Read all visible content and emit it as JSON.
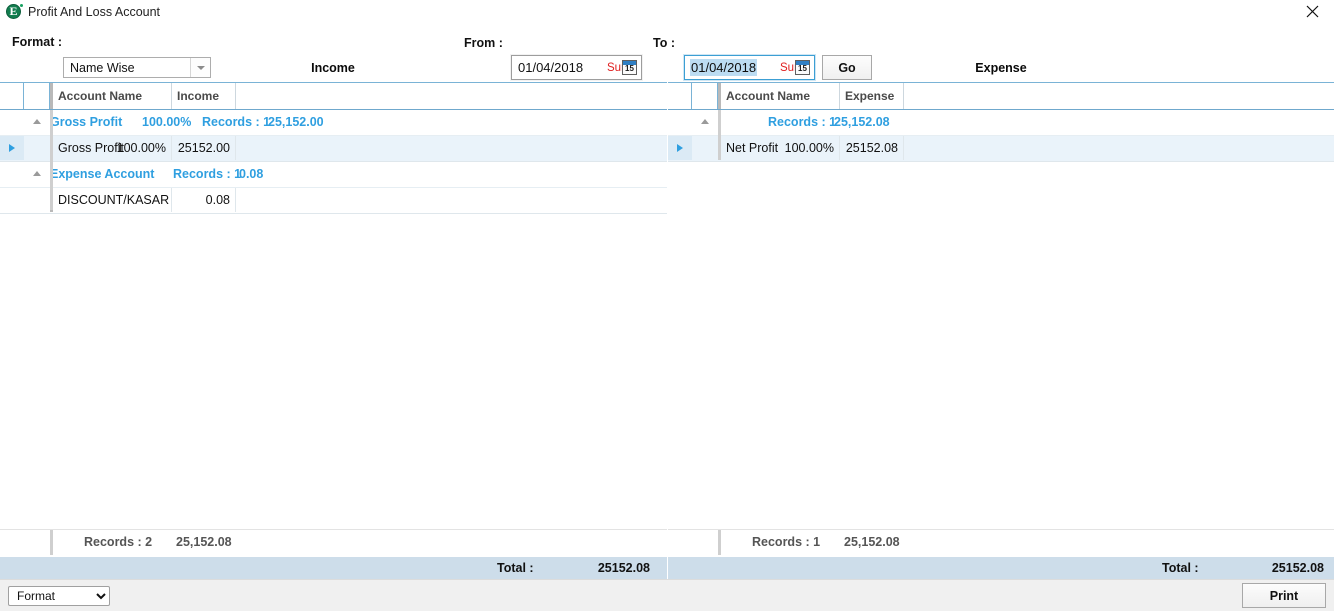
{
  "window": {
    "title": "Profit And Loss Account",
    "icon": "app-logo-icon",
    "close_label": "✕"
  },
  "toolbar": {
    "format_label": "Format :",
    "format_value": "Name Wise",
    "from_label": "From :",
    "from_date": "01/04/2018",
    "from_day": "Sun",
    "to_label": "To :",
    "to_date": "01/04/2018",
    "to_day": "Sun",
    "calendar_day_number": "15",
    "go_label": "Go"
  },
  "income_panel": {
    "caption": "Income",
    "columns": [
      "Account Name",
      "Income"
    ],
    "groups": [
      {
        "name": "Gross Profit",
        "percent": "100.00%",
        "records_label": "Records : 1",
        "sum": "25,152.00",
        "rows": [
          {
            "account": "Gross Profit",
            "percent": "100.00%",
            "amount": "25152.00",
            "selected": true
          }
        ]
      },
      {
        "name": "Expense Account",
        "percent": "",
        "records_label": "Records : 1",
        "sum": "0.08",
        "rows": [
          {
            "account": "DISCOUNT/KASAR",
            "percent": "",
            "amount": "0.08",
            "selected": false
          }
        ]
      }
    ],
    "footer": {
      "records_label": "Records : 2",
      "sum": "25,152.08"
    },
    "total": {
      "label": "Total :",
      "value": "25152.08"
    }
  },
  "expense_panel": {
    "caption": "Expense",
    "columns": [
      "Account Name",
      "Expense"
    ],
    "groups": [
      {
        "name": "",
        "percent": "",
        "records_label": "Records : 1",
        "sum": "25,152.08",
        "rows": [
          {
            "account": "Net Profit",
            "percent": "100.00%",
            "amount": "25152.08",
            "selected": true
          }
        ]
      }
    ],
    "footer": {
      "records_label": "Records : 1",
      "sum": "25,152.08"
    },
    "total": {
      "label": "Total :",
      "value": "25152.08"
    }
  },
  "bottombar": {
    "format_select_value": "Format",
    "format_select_options": [
      "Format"
    ],
    "print_label": "Print"
  },
  "colors": {
    "accent_blue": "#2f9fe0",
    "header_border": "#6fa8cd",
    "total_bar": "#cdddea",
    "selected_row": "#eaf3fa",
    "day_red": "#e02020",
    "logo_green": "#127d4f"
  }
}
